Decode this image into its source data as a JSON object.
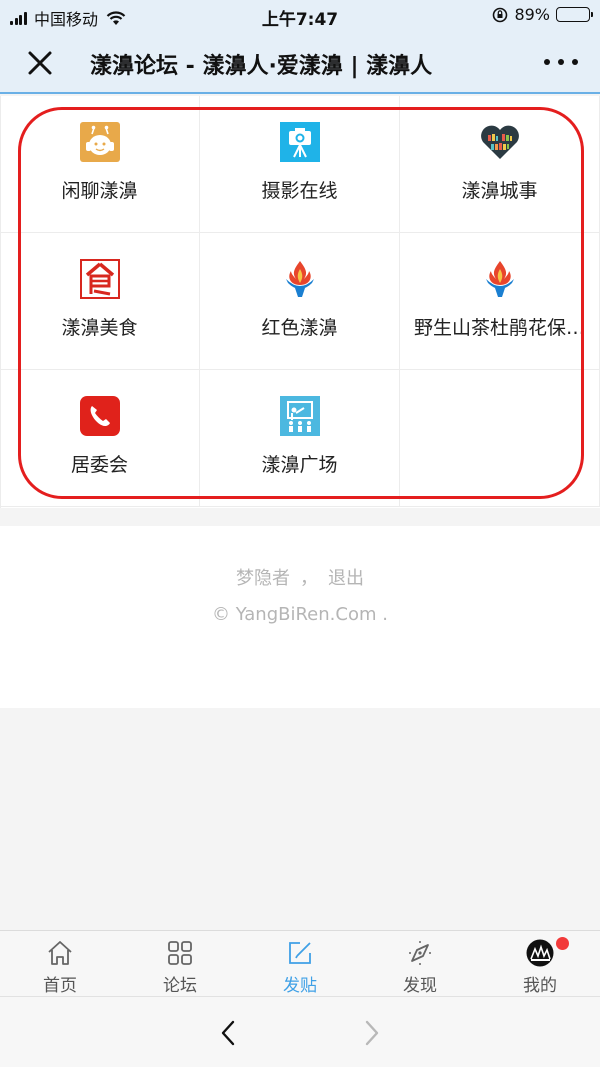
{
  "status_bar": {
    "carrier": "中国移动",
    "time": "上午7:47",
    "battery": "89%",
    "battery_level": 0.89
  },
  "nav": {
    "title": "漾濞论坛 - 漾濞人·爱漾濞 | 漾濞人"
  },
  "forums": [
    {
      "label": "闲聊漾濞",
      "icon": "robot-headphones-icon"
    },
    {
      "label": "摄影在线",
      "icon": "camera-tripod-icon"
    },
    {
      "label": "漾濞城事",
      "icon": "heart-bookshelf-icon"
    },
    {
      "label": "漾濞美食",
      "icon": "food-character-icon"
    },
    {
      "label": "红色漾濞",
      "icon": "torch-flame-icon"
    },
    {
      "label": "野生山茶杜鹃花保…",
      "icon": "torch-flame-icon"
    },
    {
      "label": "居委会",
      "icon": "phone-icon"
    },
    {
      "label": "漾濞广场",
      "icon": "classroom-board-icon"
    }
  ],
  "footer": {
    "username": "梦隐者",
    "separator": "，",
    "logout": "退出",
    "copyright": "© YangBiRen.Com ."
  },
  "tabs": [
    {
      "label": "首页",
      "icon": "home-icon"
    },
    {
      "label": "论坛",
      "icon": "grid-icon"
    },
    {
      "label": "发贴",
      "icon": "edit-icon",
      "active": true
    },
    {
      "label": "发现",
      "icon": "compass-icon"
    },
    {
      "label": "我的",
      "icon": "avatar-icon",
      "badge": true
    }
  ],
  "colors": {
    "accent": "#3fa0e6",
    "highlight": "#e41e1e",
    "nav_bg": "#e5eff8",
    "badge": "#f23a3a"
  }
}
